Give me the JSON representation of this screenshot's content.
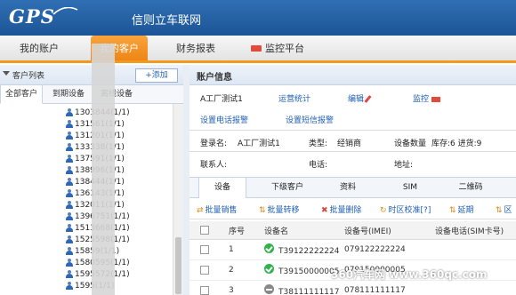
{
  "header": {
    "logo": "GPS",
    "brand": "信则立车联网"
  },
  "nav": {
    "tabs": [
      "我的账户",
      "我的客户",
      "财务报表",
      "监控平台"
    ],
    "active": "我的客户"
  },
  "left": {
    "title": "客户列表",
    "add_label": "+添加",
    "tabs": [
      "全部客户",
      "到期设备",
      "离线设备"
    ],
    "items": [
      "1303844(1/1)",
      "131561(1/1)",
      "131201(1/1)",
      "133338(1/1)",
      "137591(1/1)",
      "138996(1/1)",
      "138444(1/1)",
      "136143(1/1)",
      "132011(1/1)",
      "1396751(1/1)",
      "1513668(1/1)",
      "1525598(1/1)",
      "15859(1/1)",
      "1580595(1/1)",
      "1595572(1/1)",
      "1595(1/1)"
    ]
  },
  "account": {
    "title": "账户信息",
    "name": "A工厂测试1",
    "links": {
      "stats": "运营统计",
      "edit": "编辑",
      "monitor": "监控",
      "phone_alarm": "设置电话报警",
      "sms_alarm": "设置短信报警"
    },
    "fields": {
      "login_label": "登录名:",
      "login_value": "A工厂测试1",
      "type_label": "类型:",
      "type_value": "经销商",
      "device_count_label": "设备数量",
      "device_count_value": "库存:6 进货:9",
      "contact_label": "联系人:",
      "phone_label": "电话:",
      "address_label": "地址:"
    }
  },
  "device_tabs": [
    "设备",
    "下级客户",
    "资料",
    "SIM",
    "二维码"
  ],
  "toolbar": [
    "批量销售",
    "批量转移",
    "批量删除",
    "时区校准[?]",
    "延期",
    "区"
  ],
  "table": {
    "headers": [
      "序号",
      "设备名",
      "设备号(IMEI)",
      "设备电话(SIM卡号)"
    ],
    "rows": [
      {
        "no": "1",
        "status": "online",
        "name": "T39122222224",
        "imei": "079122222224"
      },
      {
        "no": "2",
        "status": "online",
        "name": "T39150000005",
        "imei": "079150000005"
      },
      {
        "no": "3",
        "status": "offline",
        "name": "T38111111117",
        "imei": "078111111117"
      }
    ]
  },
  "watermark": "360汽车网 www.360qc.com"
}
